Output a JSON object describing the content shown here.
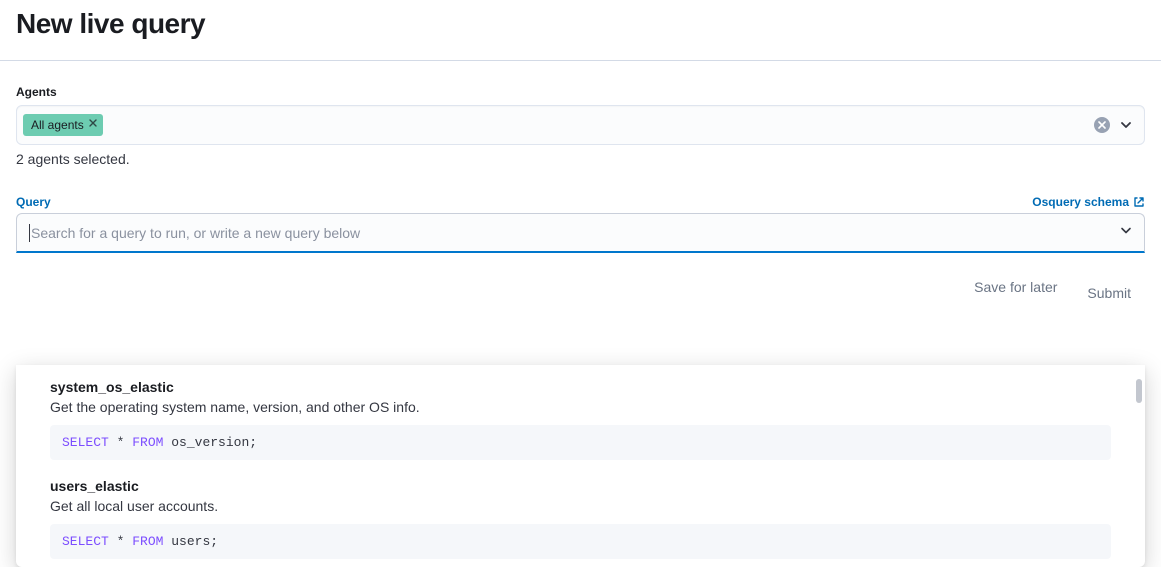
{
  "page": {
    "title": "New live query"
  },
  "agents": {
    "label": "Agents",
    "pill": "All agents",
    "helper": "2 agents selected."
  },
  "query": {
    "label": "Query",
    "schema_link": "Osquery schema",
    "placeholder": "Search for a query to run, or write a new query below"
  },
  "suggestions": [
    {
      "name": "system_os_elastic",
      "description": "Get the operating system name, version, and other OS info.",
      "sql_kw1": "SELECT",
      "sql_star": " * ",
      "sql_kw2": "FROM",
      "sql_ident": " os_version",
      "sql_end": ";"
    },
    {
      "name": "users_elastic",
      "description": "Get all local user accounts.",
      "sql_kw1": "SELECT",
      "sql_star": " * ",
      "sql_kw2": "FROM",
      "sql_ident": " users",
      "sql_end": ";"
    }
  ],
  "footer": {
    "save": "Save for later",
    "submit": "Submit"
  }
}
